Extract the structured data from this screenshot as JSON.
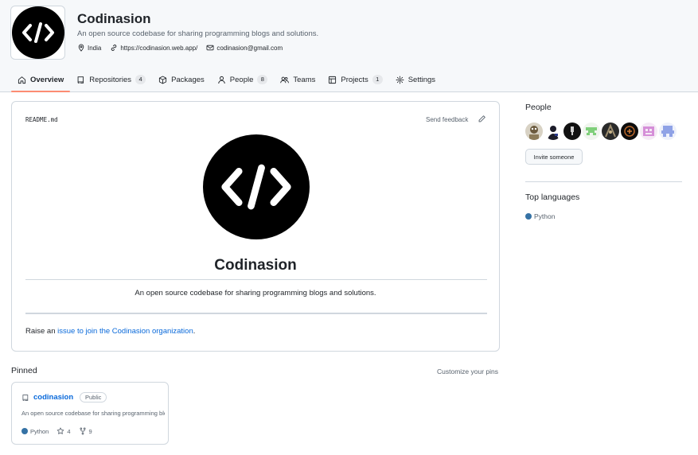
{
  "org": {
    "name": "Codinasion",
    "description": "An open source codebase for sharing programming blogs and solutions.",
    "location": "India",
    "website": "https://codinasion.web.app/",
    "email": "codinasion@gmail.com",
    "logo_text": "</>"
  },
  "nav": {
    "tabs": [
      {
        "label": "Overview",
        "icon": "book-icon",
        "active": true
      },
      {
        "label": "Repositories",
        "icon": "repo-icon",
        "count": "4"
      },
      {
        "label": "Packages",
        "icon": "package-icon"
      },
      {
        "label": "People",
        "icon": "person-icon",
        "count": "8"
      },
      {
        "label": "Teams",
        "icon": "people-icon"
      },
      {
        "label": "Projects",
        "icon": "table-icon",
        "count": "1"
      },
      {
        "label": "Settings",
        "icon": "gear-icon"
      }
    ]
  },
  "readme": {
    "filename": "README.md",
    "send_feedback": "Send feedback",
    "title": "Codinasion",
    "description": "An open source codebase for sharing programming blogs and solutions.",
    "raise_prefix": "Raise an ",
    "raise_link": "issue to join the Codinasion organization",
    "raise_suffix": "."
  },
  "pinned": {
    "title": "Pinned",
    "customize": "Customize your pins",
    "cards": [
      {
        "name": "codinasion",
        "visibility": "Public",
        "description": "An open source codebase for sharing programming blogs and solutions.",
        "language": "Python",
        "language_color": "#3572A5",
        "stars": "4",
        "forks": "9"
      }
    ]
  },
  "sidebar": {
    "people_title": "People",
    "invite_label": "Invite someone",
    "top_languages_title": "Top languages",
    "languages": [
      {
        "name": "Python",
        "color": "#3572A5"
      }
    ]
  }
}
